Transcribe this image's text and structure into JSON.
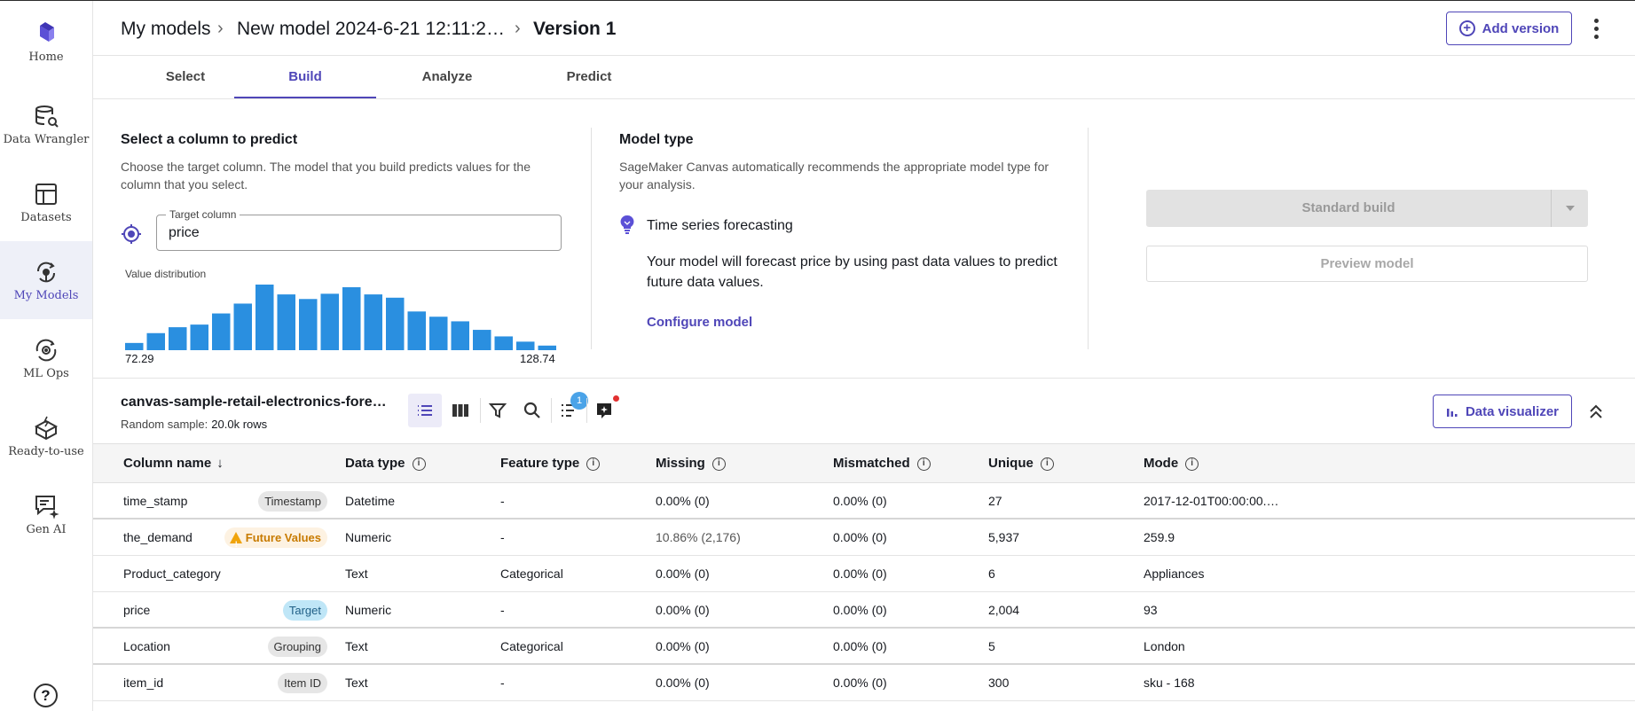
{
  "nav": {
    "items": [
      {
        "label": "Home",
        "icon": "canvas-logo-icon"
      },
      {
        "label": "Data Wrangler",
        "icon": "data-wrangler-icon"
      },
      {
        "label": "Datasets",
        "icon": "datasets-icon"
      },
      {
        "label": "My Models",
        "icon": "my-models-icon",
        "active": true
      },
      {
        "label": "ML Ops",
        "icon": "ml-ops-icon"
      },
      {
        "label": "Ready-to-use",
        "icon": "ready-to-use-icon"
      },
      {
        "label": "Gen AI",
        "icon": "gen-ai-icon"
      }
    ],
    "help": "?"
  },
  "header": {
    "breadcrumb": [
      "My models",
      "New model 2024-6-21 12:11:2…",
      "Version 1"
    ],
    "add_version": "Add version"
  },
  "tabs": [
    "Select",
    "Build",
    "Analyze",
    "Predict"
  ],
  "active_tab": "Build",
  "target": {
    "title": "Select a column to predict",
    "description": "Choose the target column. The model that you build predicts values for the column that you select.",
    "field_label": "Target column",
    "field_value": "price",
    "distribution_label": "Value distribution",
    "dist_min": "72.29",
    "dist_max": "128.74",
    "histogram": [
      0.11,
      0.26,
      0.35,
      0.39,
      0.56,
      0.71,
      1.0,
      0.85,
      0.78,
      0.86,
      0.96,
      0.85,
      0.8,
      0.59,
      0.51,
      0.44,
      0.31,
      0.21,
      0.13,
      0.07
    ]
  },
  "model_type": {
    "title": "Model type",
    "description": "SageMaker Canvas automatically recommends the appropriate model type for your analysis.",
    "name": "Time series forecasting",
    "detail": "Your model will forecast price by using past data values to predict future data values.",
    "configure": "Configure model"
  },
  "actions": {
    "standard_build": "Standard build",
    "preview": "Preview model"
  },
  "dataset": {
    "name": "canvas-sample-retail-electronics-fore…",
    "sample_label": "Random sample:",
    "sample_value": "20.0k rows",
    "sort_badge": "1",
    "visualizer": "Data visualizer"
  },
  "columns": {
    "name": "Column name",
    "data_type": "Data type",
    "feature_type": "Feature type",
    "missing": "Missing",
    "mismatched": "Mismatched",
    "unique": "Unique",
    "mode": "Mode"
  },
  "rows": [
    {
      "name": "time_stamp",
      "chip": "Timestamp",
      "chip_kind": "gray",
      "data_type": "Datetime",
      "feature_type": "-",
      "missing": "0.00% (0)",
      "mismatched": "0.00% (0)",
      "unique": "27",
      "mode": "2017-12-01T00:00:00.…"
    },
    {
      "name": "the_demand",
      "chip": "Future Values",
      "chip_kind": "future",
      "data_type": "Numeric",
      "feature_type": "-",
      "missing": "10.86% (2,176)",
      "mismatched": "0.00% (0)",
      "unique": "5,937",
      "mode": "259.9"
    },
    {
      "name": "Product_category",
      "chip": "",
      "chip_kind": "",
      "data_type": "Text",
      "feature_type": "Categorical",
      "missing": "0.00% (0)",
      "mismatched": "0.00% (0)",
      "unique": "6",
      "mode": "Appliances"
    },
    {
      "name": "price",
      "chip": "Target",
      "chip_kind": "target",
      "data_type": "Numeric",
      "feature_type": "-",
      "missing": "0.00% (0)",
      "mismatched": "0.00% (0)",
      "unique": "2,004",
      "mode": "93"
    },
    {
      "name": "Location",
      "chip": "Grouping",
      "chip_kind": "gray",
      "data_type": "Text",
      "feature_type": "Categorical",
      "missing": "0.00% (0)",
      "mismatched": "0.00% (0)",
      "unique": "5",
      "mode": "London"
    },
    {
      "name": "item_id",
      "chip": "Item ID",
      "chip_kind": "gray",
      "data_type": "Text",
      "feature_type": "-",
      "missing": "0.00% (0)",
      "mismatched": "0.00% (0)",
      "unique": "300",
      "mode": "sku - 168"
    }
  ],
  "colors": {
    "accent": "#4f46b8",
    "bar": "#2a8fe0",
    "warning": "#f0a30a"
  }
}
